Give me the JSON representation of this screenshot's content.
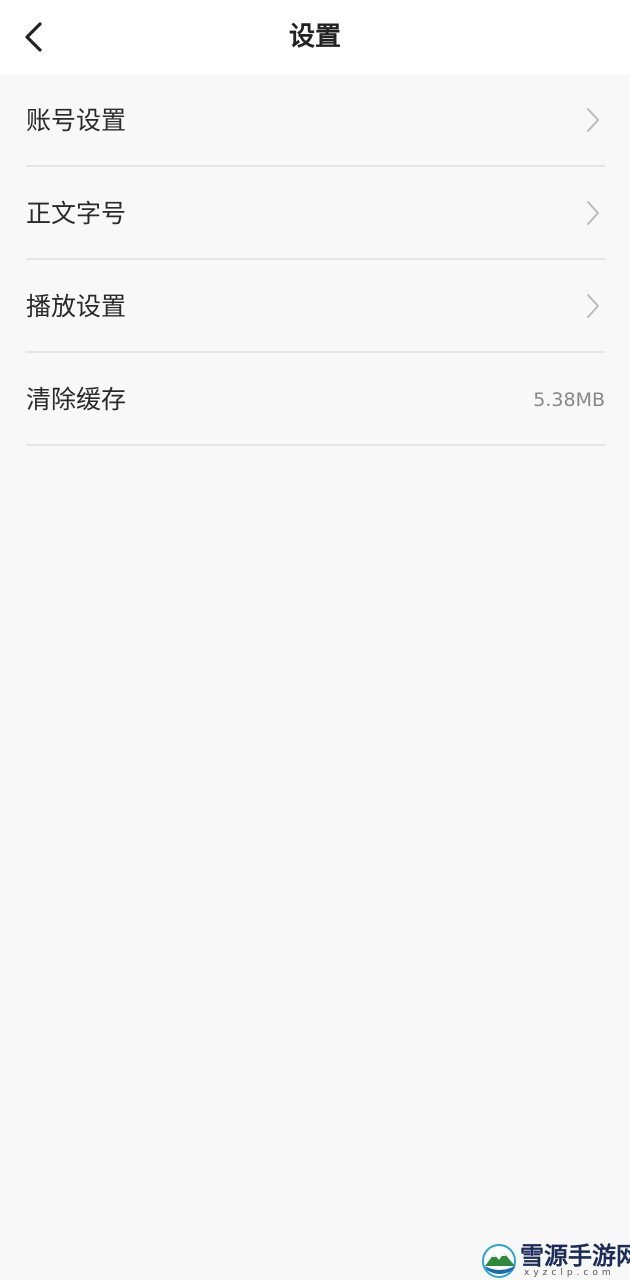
{
  "header": {
    "title": "设置",
    "back_icon": "chevron-left-icon"
  },
  "settings": {
    "items": [
      {
        "label": "账号设置",
        "icon": "chevron-right-icon"
      },
      {
        "label": "正文字号",
        "icon": "chevron-right-icon"
      },
      {
        "label": "播放设置",
        "icon": "chevron-right-icon"
      },
      {
        "label": "清除缓存",
        "value": "5.38MB"
      }
    ]
  },
  "watermark": {
    "title": "雪源手游网",
    "subtitle": "xyzclp.com",
    "logo_icon": "mountain-logo-icon"
  },
  "colors": {
    "background": "#f8f8f8",
    "header_background": "#ffffff",
    "divider": "#e6e6e6",
    "secondary_text": "#888888",
    "chevron": "#bbbbbb"
  }
}
